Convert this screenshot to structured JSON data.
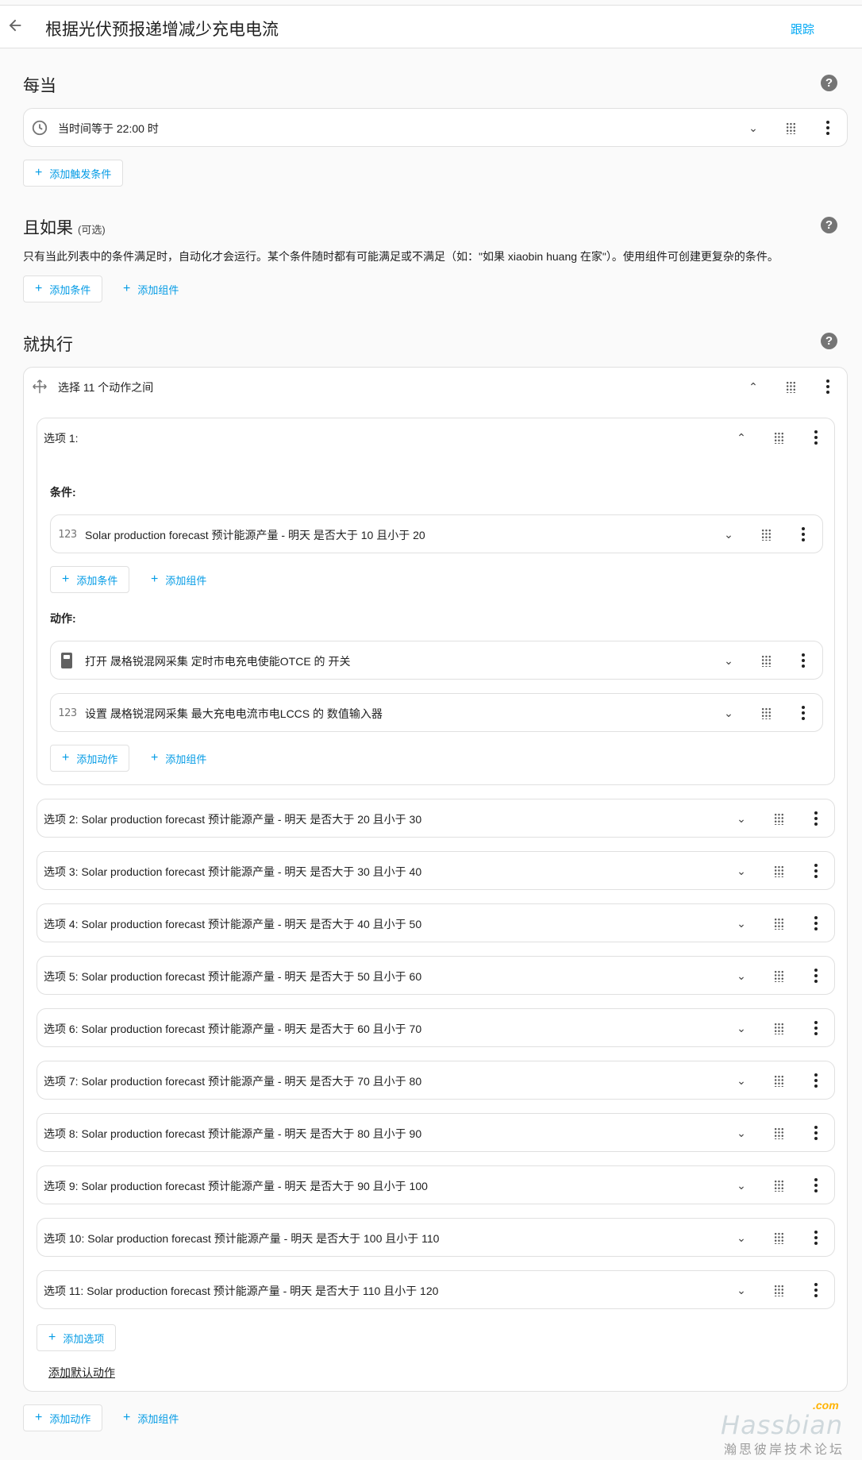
{
  "header": {
    "title": "根据光伏预报递增减少充电电流",
    "trace_label": "跟踪"
  },
  "triggers": {
    "title": "每当",
    "items": [
      {
        "label": "当时间等于 22:00 时",
        "icon": "clock-icon"
      }
    ],
    "add_label": "添加触发条件"
  },
  "conditions": {
    "title": "且如果",
    "optional": "(可选)",
    "description": "只有当此列表中的条件满足时，自动化才会运行。某个条件随时都有可能满足或不满足（如：\"如果 xiaobin huang 在家\"）。使用组件可创建更复杂的条件。",
    "add_condition": "添加条件",
    "add_building_block": "添加组件"
  },
  "actions": {
    "title": "就执行",
    "choose": {
      "label": "选择 11 个动作之间",
      "option1": {
        "label": "选项 1:",
        "conditions_label": "条件:",
        "condition": "Solar production forecast 预计能源产量 - 明天 是否大于 10 且小于 20",
        "add_condition": "添加条件",
        "add_building_block": "添加组件",
        "actions_label": "动作:",
        "action1": "打开 晟格锐混网采集 定时市电充电使能OTCE 的 开关",
        "action2": "设置 晟格锐混网采集 最大充电电流市电LCCS 的 数值输入器",
        "add_action": "添加动作",
        "add_building_block2": "添加组件"
      },
      "options": [
        "选项 2: Solar production forecast 预计能源产量 - 明天 是否大于 20 且小于 30",
        "选项 3: Solar production forecast 预计能源产量 - 明天 是否大于 30 且小于 40",
        "选项 4: Solar production forecast 预计能源产量 - 明天 是否大于 40 且小于 50",
        "选项 5: Solar production forecast 预计能源产量 - 明天 是否大于 50 且小于 60",
        "选项 6: Solar production forecast 预计能源产量 - 明天 是否大于 60 且小于 70",
        "选项 7: Solar production forecast 预计能源产量 - 明天 是否大于 70 且小于 80",
        "选项 8: Solar production forecast 预计能源产量 - 明天 是否大于 80 且小于 90",
        "选项 9: Solar production forecast 预计能源产量 - 明天 是否大于 90 且小于 100",
        "选项 10: Solar production forecast 预计能源产量 - 明天 是否大于 100 且小于 110",
        "选项 11: Solar production forecast 预计能源产量 - 明天 是否大于 110 且小于 120"
      ],
      "add_option": "添加选项",
      "add_default": "添加默认动作"
    },
    "add_action": "添加动作",
    "add_building_block": "添加组件"
  },
  "icons": {
    "number": "123",
    "help": "?"
  },
  "watermark": {
    "brand": "Hassbian",
    "com": ".com",
    "cn": "瀚思彼岸技术论坛"
  },
  "colors": {
    "accent": "#03a9f4",
    "background": "#fafafa",
    "card": "#ffffff",
    "border": "#e0e0e0"
  }
}
